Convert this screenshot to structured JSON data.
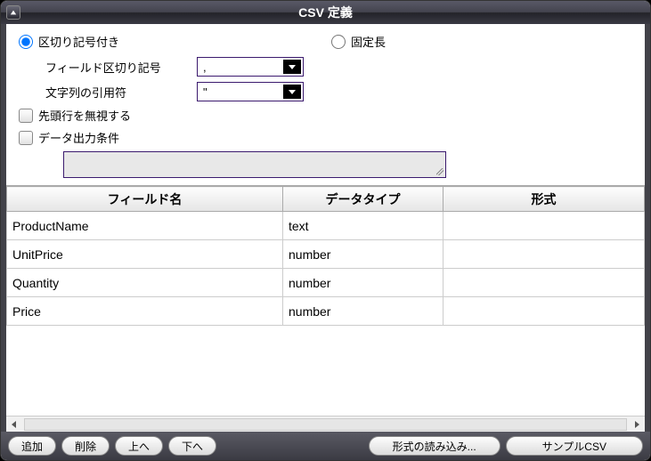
{
  "title": "CSV 定義",
  "radios": {
    "delimited": "区切り記号付き",
    "fixed": "固定長"
  },
  "fields": {
    "separator_label": "フィールド区切り記号",
    "separator_value": ",",
    "quote_label": "文字列の引用符",
    "quote_value": "\""
  },
  "checks": {
    "ignore_header": "先頭行を無視する",
    "output_condition": "データ出力条件"
  },
  "condition_text": "",
  "columns": {
    "name": "フィールド名",
    "type": "データタイプ",
    "format": "形式"
  },
  "rows": [
    {
      "name": "ProductName",
      "type": "text",
      "format": ""
    },
    {
      "name": "UnitPrice",
      "type": "number",
      "format": ""
    },
    {
      "name": "Quantity",
      "type": "number",
      "format": ""
    },
    {
      "name": "Price",
      "type": "number",
      "format": ""
    }
  ],
  "buttons": {
    "add": "追加",
    "delete": "削除",
    "up": "上へ",
    "down": "下へ",
    "load_format": "形式の読み込み...",
    "sample_csv": "サンプルCSV"
  }
}
